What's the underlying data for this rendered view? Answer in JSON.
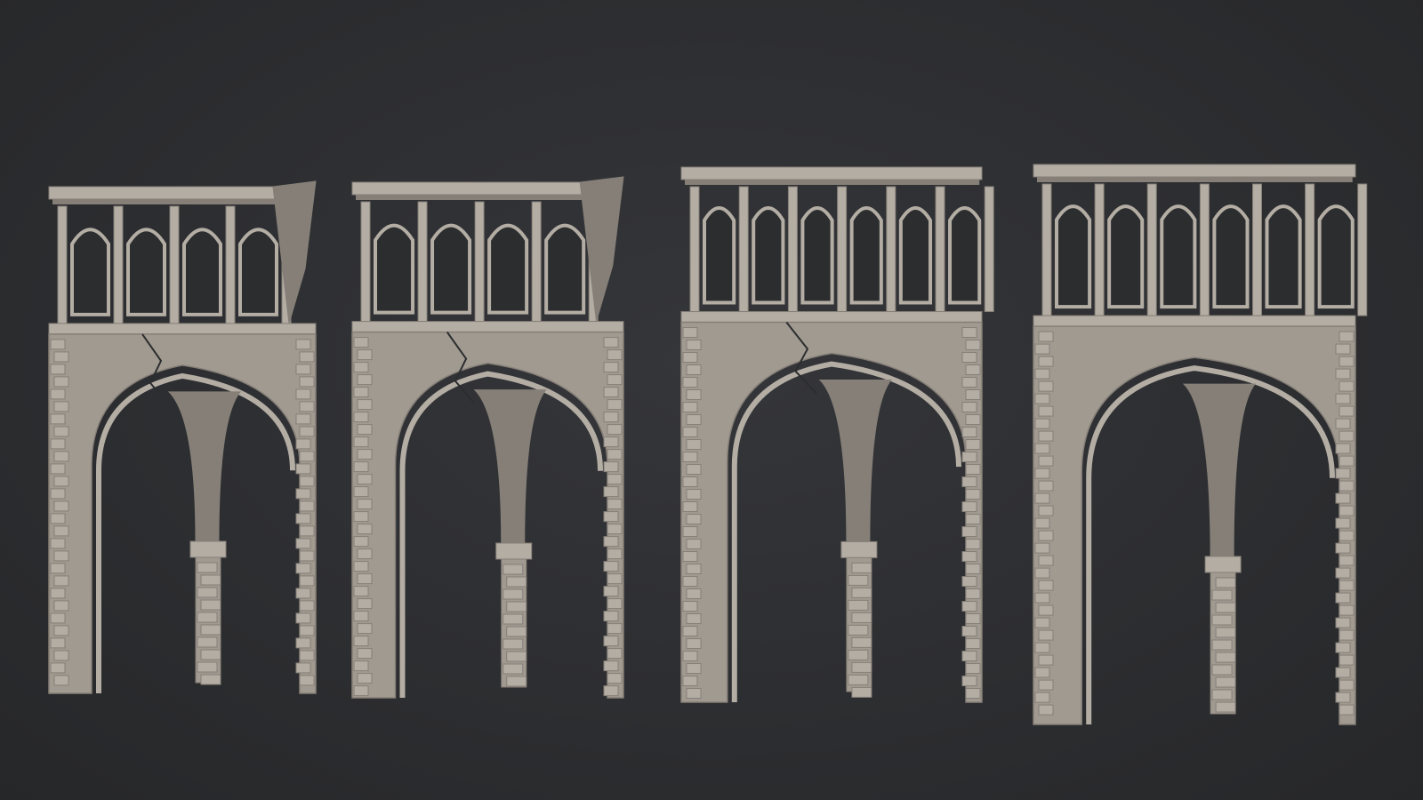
{
  "scene": {
    "background_color": "#2d2e31",
    "material_color": "#a09a91",
    "material_light": "#b3ada4",
    "material_dark": "#857f77",
    "shadow_color": "#2c2d2f"
  },
  "modules": [
    {
      "name": "ruined-arch-module-1",
      "damage": "heavy",
      "window_count": 4,
      "damage_side": "right"
    },
    {
      "name": "ruined-arch-module-2",
      "damage": "heavy",
      "window_count": 4,
      "damage_side": "right"
    },
    {
      "name": "ruined-arch-module-3",
      "damage": "medium",
      "window_count": 6,
      "damage_side": "top"
    },
    {
      "name": "ruined-arch-module-4",
      "damage": "light",
      "window_count": 6,
      "damage_side": "top"
    }
  ]
}
